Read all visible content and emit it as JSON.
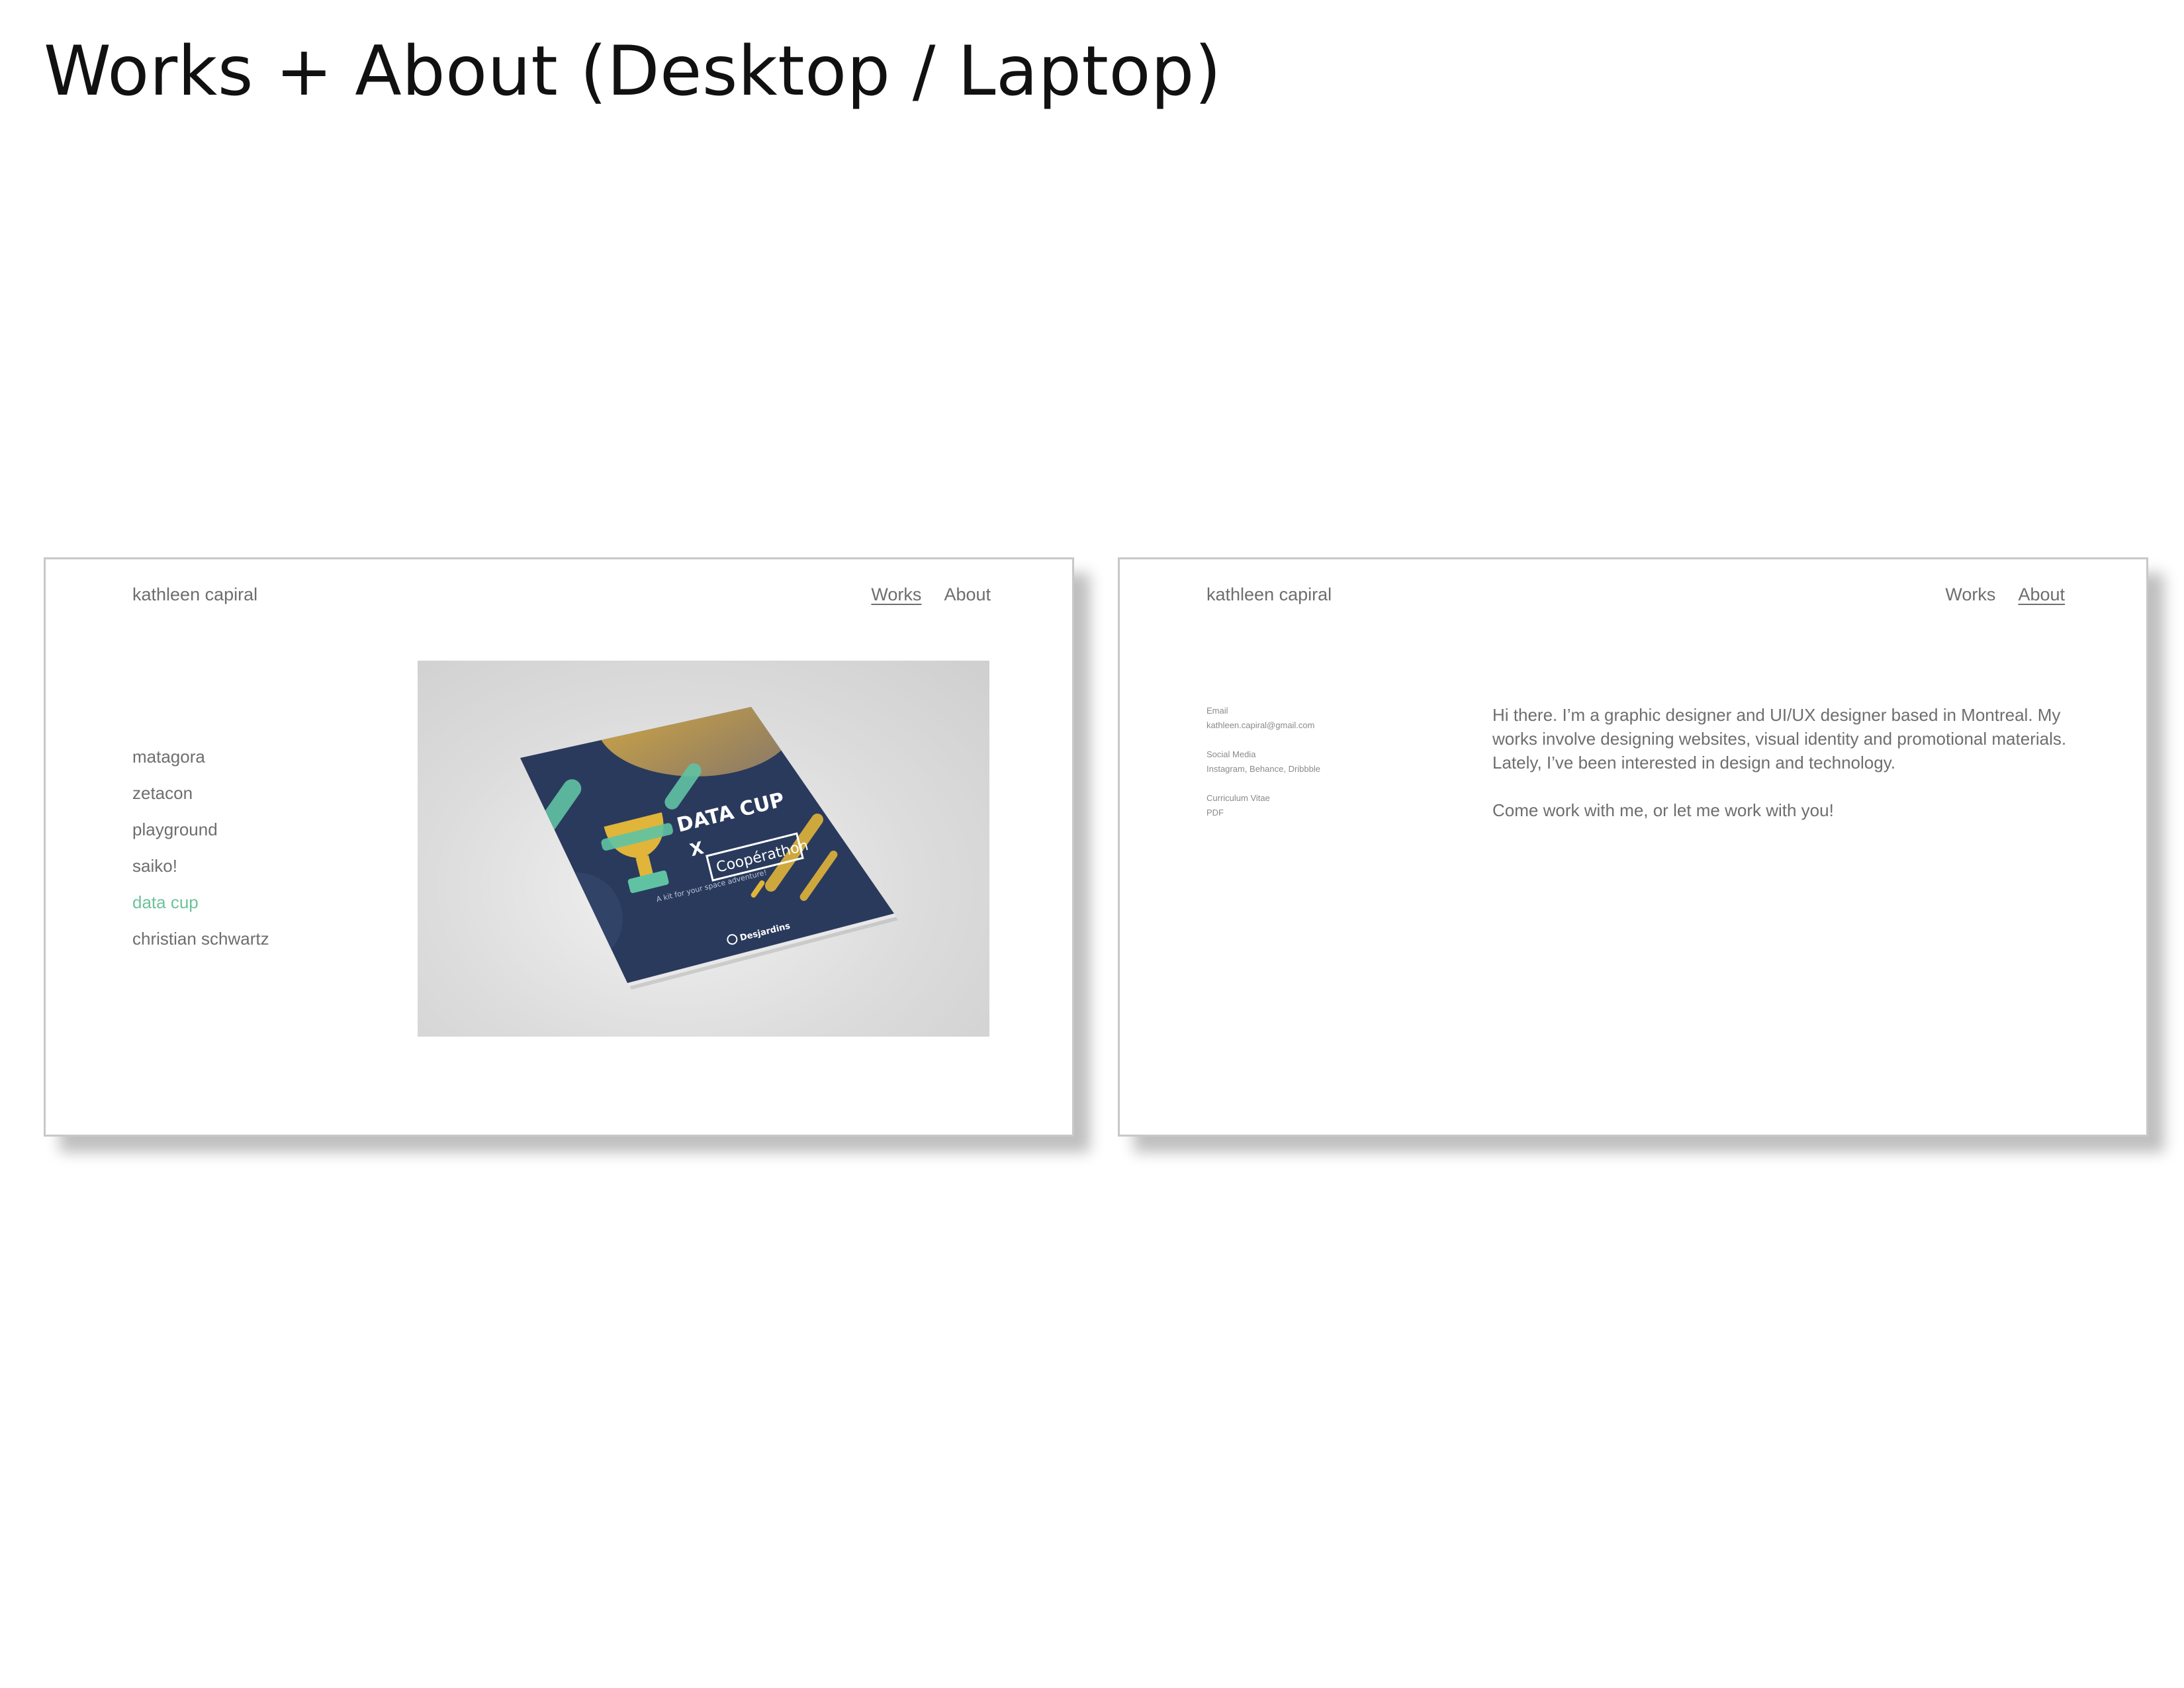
{
  "page_title": "Works + About (Desktop / Laptop)",
  "colors": {
    "accent": "#6cc39b",
    "text": "#6e6e6e",
    "booklet_navy": "#2a3a5c",
    "booklet_gold": "#e0b53a",
    "booklet_teal": "#5fc3a3"
  },
  "works_page": {
    "brand": "kathleen capiral",
    "nav": {
      "works": "Works",
      "about": "About",
      "active": "Works"
    },
    "projects": [
      {
        "label": "matagora",
        "active": false
      },
      {
        "label": "zetacon",
        "active": false
      },
      {
        "label": "playground",
        "active": false
      },
      {
        "label": "saiko!",
        "active": false
      },
      {
        "label": "data cup",
        "active": true
      },
      {
        "label": "christian schwartz",
        "active": false
      }
    ],
    "preview": {
      "title_line1": "DATA CUP",
      "title_line2": "X",
      "partner": "Coopérathon",
      "tagline": "A kit for your space adventure!",
      "sponsor": "Desjardins"
    }
  },
  "about_page": {
    "brand": "kathleen capiral",
    "nav": {
      "works": "Works",
      "about": "About",
      "active": "About"
    },
    "contact": {
      "email_label": "Email",
      "email_value": "kathleen.capiral@gmail.com",
      "social_label": "Social Media",
      "social_value": "Instagram, Behance, Dribbble",
      "cv_label": "Curriculum Vitae",
      "cv_value": "PDF"
    },
    "bio": {
      "paragraph1": "Hi there. I’m a graphic designer and UI/UX designer based in Montreal. My works involve designing websites, visual identity and promotional materials. Lately, I’ve been interested in design and technology.",
      "paragraph2": "Come work with me, or let me work with you!"
    }
  }
}
